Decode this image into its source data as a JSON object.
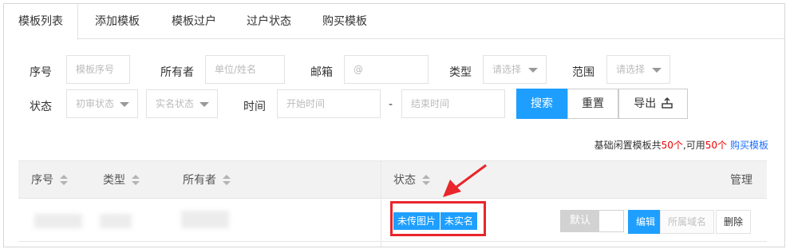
{
  "tabs": [
    "模板列表",
    "添加模板",
    "模板过户",
    "过户状态",
    "购买模板"
  ],
  "filters": {
    "id_label": "序号",
    "id_placeholder": "模板序号",
    "owner_label": "所有者",
    "owner_placeholder": "单位/姓名",
    "email_label": "邮箱",
    "email_placeholder": "@",
    "type_label": "类型",
    "type_value": "请选择",
    "scope_label": "范围",
    "scope_value": "请选择",
    "status_label": "状态",
    "review_status": "初审状态",
    "realname_status": "实名状态",
    "time_label": "时间",
    "start_placeholder": "开始时间",
    "dash": "-",
    "end_placeholder": "结束时间"
  },
  "buttons": {
    "search": "搜索",
    "reset": "重置",
    "export": "导出"
  },
  "summary": {
    "prefix": "基础闲置模板共",
    "total": "50个",
    "mid": ",可用",
    "available": "50个",
    "link": "购买模板"
  },
  "table": {
    "headers": [
      "序号",
      "类型",
      "所有者",
      "状态",
      "管理"
    ],
    "row": {
      "tags": [
        "未传图片",
        "未实名"
      ],
      "toggle_label": "默认",
      "actions": [
        "编辑",
        "所属域名",
        "删除"
      ]
    }
  },
  "colors": {
    "primary": "#1e9fff",
    "annotation": "#e8262b"
  }
}
